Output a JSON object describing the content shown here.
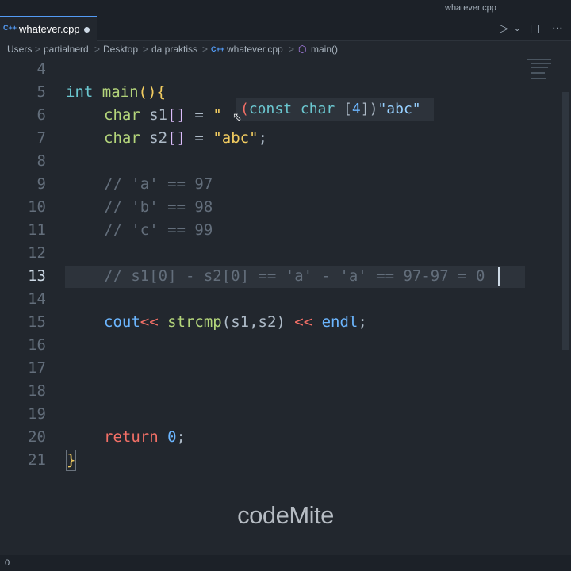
{
  "window": {
    "title": "whatever.cpp"
  },
  "tab": {
    "lang_icon": "C++",
    "filename": "whatever.cpp",
    "modified_icon": "modified-dot-icon"
  },
  "toolbar": {
    "run_icon": "run-debug-icon",
    "split_icon": "split-editor-icon",
    "more_icon": "more-actions-icon"
  },
  "breadcrumb": {
    "items": [
      "Users",
      "partialnerd",
      "Desktop",
      "da praktiss",
      "whatever.cpp",
      "main()"
    ],
    "separator": ">"
  },
  "editor": {
    "active_line": 13,
    "line_numbers": [
      "4",
      "5",
      "6",
      "7",
      "8",
      "9",
      "10",
      "11",
      "12",
      "13",
      "14",
      "15",
      "16",
      "17",
      "18",
      "19",
      "20",
      "21"
    ],
    "code": {
      "l5_int": "int",
      "l5_main": "main",
      "l5_parens": "()",
      "l5_brace": "{",
      "l6_char": "char",
      "l6_rest": " s1",
      "l6_brackets": "[]",
      "l6_eq": " = ",
      "l6_str": "\"",
      "l7_char": "char",
      "l7_rest": " s2",
      "l7_brackets": "[]",
      "l7_eq": " = ",
      "l7_str": "\"abc\"",
      "l7_semi": ";",
      "l9": "// 'a' == 97",
      "l10": "// 'b' == 98",
      "l11": "// 'c' == 99",
      "l13": "// s1[0] - s2[0] == 'a' - 'a' == 97-97 = 0",
      "l15_cout": "cout",
      "l15_op1": "<<",
      "l15_fn": "strcmp",
      "l15_args": "(s1,s2)",
      "l15_op2": " << ",
      "l15_endl": "endl",
      "l15_semi": ";",
      "l20_return": "return",
      "l20_zero": "0",
      "l20_semi": ";",
      "l21_brace": "}"
    }
  },
  "hover_tooltip": {
    "open": "(",
    "type": "const char",
    "bracket_open": " [",
    "size": "4",
    "bracket_close": "])",
    "value": "\"abc\""
  },
  "watermark": {
    "text": "codeMite"
  },
  "statusbar": {
    "text": "0"
  }
}
